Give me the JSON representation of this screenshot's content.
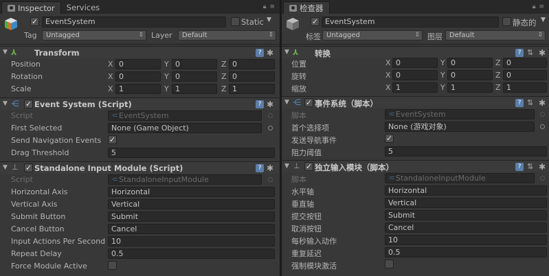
{
  "left": {
    "tabs": [
      "Inspector",
      "Services"
    ],
    "object_name": "EventSystem",
    "static_label": "Static",
    "tag_label": "Tag",
    "tag_value": "Untagged",
    "layer_label": "Layer",
    "layer_value": "Default",
    "transform": {
      "title": "Transform",
      "rows": [
        {
          "label": "Position",
          "x": "0",
          "y": "0",
          "z": "0"
        },
        {
          "label": "Rotation",
          "x": "0",
          "y": "0",
          "z": "0"
        },
        {
          "label": "Scale",
          "x": "1",
          "y": "1",
          "z": "1"
        }
      ]
    },
    "event_system": {
      "title": "Event System (Script)",
      "script_label": "Script",
      "script_value": "EventSystem",
      "first_selected_label": "First Selected",
      "first_selected_value": "None (Game Object)",
      "send_nav_label": "Send Navigation Events",
      "drag_label": "Drag Threshold",
      "drag_value": "5"
    },
    "standalone": {
      "title": "Standalone Input Module (Script)",
      "script_label": "Script",
      "script_value": "StandaloneInputModule",
      "rows": [
        {
          "label": "Horizontal Axis",
          "value": "Horizontal"
        },
        {
          "label": "Vertical Axis",
          "value": "Vertical"
        },
        {
          "label": "Submit Button",
          "value": "Submit"
        },
        {
          "label": "Cancel Button",
          "value": "Cancel"
        },
        {
          "label": "Input Actions Per Second",
          "value": "10"
        },
        {
          "label": "Repeat Delay",
          "value": "0.5"
        }
      ],
      "force_label": "Force Module Active"
    }
  },
  "right": {
    "tabs": [
      "检查器"
    ],
    "object_name": "EventSystem",
    "static_label": "静态的",
    "tag_label": "标签",
    "tag_value": "Untagged",
    "layer_label": "图层",
    "layer_value": "Default",
    "transform": {
      "title": "转换",
      "rows": [
        {
          "label": "位置",
          "x": "0",
          "y": "0",
          "z": "0"
        },
        {
          "label": "旋转",
          "x": "0",
          "y": "0",
          "z": "0"
        },
        {
          "label": "缩放",
          "x": "1",
          "y": "1",
          "z": "1"
        }
      ]
    },
    "event_system": {
      "title": "事件系统（脚本）",
      "script_label": "脚本",
      "script_value": "EventSystem",
      "first_selected_label": "首个选择项",
      "first_selected_value": "None (游戏对象)",
      "send_nav_label": "发送导航事件",
      "drag_label": "阻力阈值",
      "drag_value": "5"
    },
    "standalone": {
      "title": "独立输入模块（脚本）",
      "script_label": "脚本",
      "script_value": "StandaloneInputModule",
      "rows": [
        {
          "label": "水平轴",
          "value": "Horizontal"
        },
        {
          "label": "垂直轴",
          "value": "Vertical"
        },
        {
          "label": "提交按钮",
          "value": "Submit"
        },
        {
          "label": "取消按钮",
          "value": "Cancel"
        },
        {
          "label": "每秒输入动作",
          "value": "10"
        },
        {
          "label": "重复延迟",
          "value": "0.5"
        }
      ],
      "force_label": "强制模块激活"
    }
  },
  "axes": [
    "X",
    "Y",
    "Z"
  ]
}
